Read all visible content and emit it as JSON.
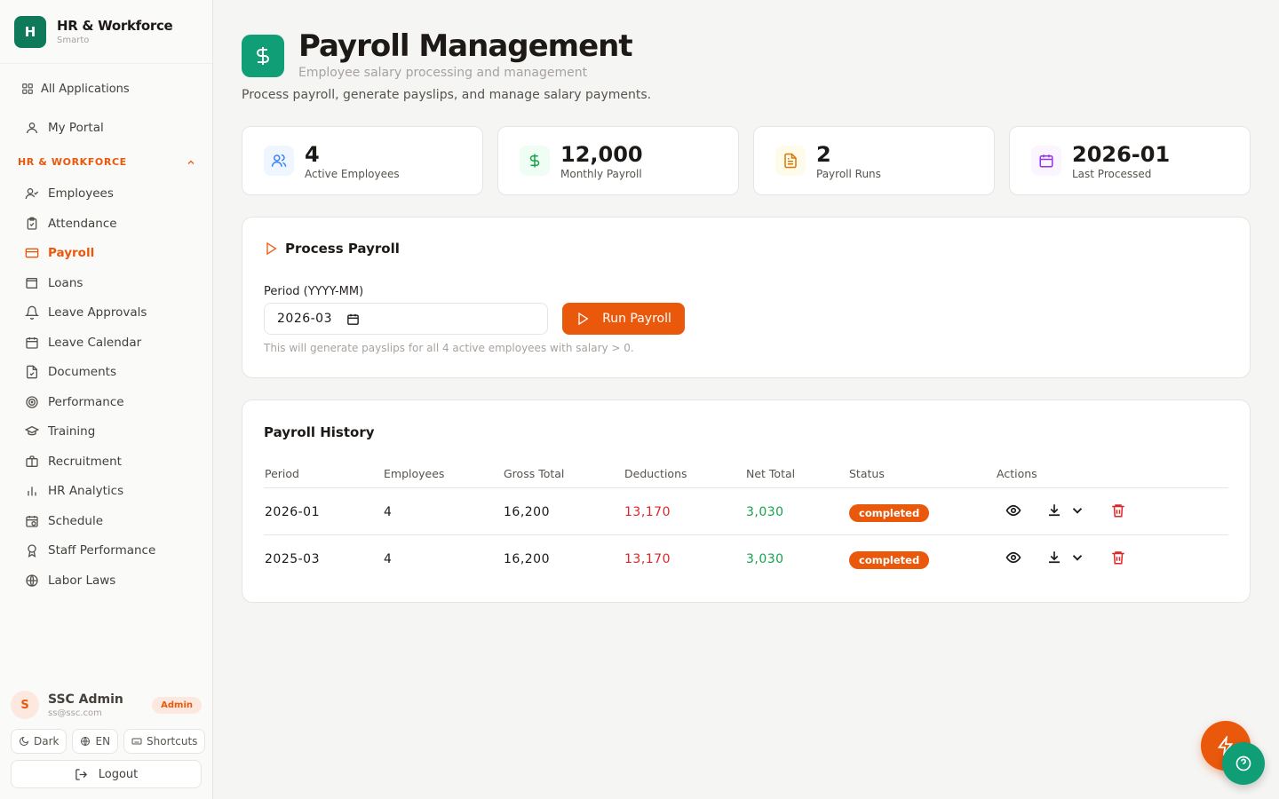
{
  "brand": {
    "logo_letter": "H",
    "title": "HR & Workforce",
    "subtitle": "Smarto"
  },
  "sidebar": {
    "all_apps": "All Applications",
    "my_portal": "My Portal",
    "section_title": "HR & WORKFORCE",
    "items": [
      {
        "label": "Employees",
        "icon": "user-check-icon"
      },
      {
        "label": "Attendance",
        "icon": "clipboard-check-icon"
      },
      {
        "label": "Payroll",
        "icon": "credit-card-icon",
        "active": true
      },
      {
        "label": "Loans",
        "icon": "wallet-icon"
      },
      {
        "label": "Leave Approvals",
        "icon": "bell-icon"
      },
      {
        "label": "Leave Calendar",
        "icon": "calendar-icon"
      },
      {
        "label": "Documents",
        "icon": "file-check-icon"
      },
      {
        "label": "Performance",
        "icon": "target-icon"
      },
      {
        "label": "Training",
        "icon": "graduation-cap-icon"
      },
      {
        "label": "Recruitment",
        "icon": "briefcase-icon"
      },
      {
        "label": "HR Analytics",
        "icon": "bar-chart-icon"
      },
      {
        "label": "Schedule",
        "icon": "calendar-clock-icon"
      },
      {
        "label": "Staff Performance",
        "icon": "award-icon"
      },
      {
        "label": "Labor Laws",
        "icon": "globe-icon"
      }
    ]
  },
  "user": {
    "initial": "S",
    "name": "SSC Admin",
    "email": "ss@ssc.com",
    "role": "Admin"
  },
  "footer": {
    "dark": "Dark",
    "lang": "EN",
    "shortcuts": "Shortcuts",
    "logout": "Logout"
  },
  "page": {
    "title": "Payroll Management",
    "subtitle": "Employee salary processing and management",
    "description": "Process payroll, generate payslips, and manage salary payments."
  },
  "stats": [
    {
      "value": "4",
      "label": "Active Employees",
      "icon": "users-icon",
      "color": "#3b82f6",
      "bg": "#eff6ff"
    },
    {
      "value": "12,000",
      "label": "Monthly Payroll",
      "icon": "dollar-icon",
      "color": "#16a34a",
      "bg": "#f0fdf4"
    },
    {
      "value": "2",
      "label": "Payroll Runs",
      "icon": "file-text-icon",
      "color": "#d97706",
      "bg": "#fffbeb"
    },
    {
      "value": "2026-01",
      "label": "Last Processed",
      "icon": "calendar-icon",
      "color": "#9333ea",
      "bg": "#faf5ff"
    }
  ],
  "process": {
    "title": "Process Payroll",
    "period_label": "Period (YYYY-MM)",
    "period_value": "2026-03",
    "run_label": "Run Payroll",
    "help": "This will generate payslips for all 4 active employees with salary > 0."
  },
  "history": {
    "title": "Payroll History",
    "columns": [
      "Period",
      "Employees",
      "Gross Total",
      "Deductions",
      "Net Total",
      "Status",
      "Actions"
    ],
    "rows": [
      {
        "period": "2026-01",
        "employees": "4",
        "gross": "16,200",
        "deductions": "13,170",
        "net": "3,030",
        "status": "completed"
      },
      {
        "period": "2025-03",
        "employees": "4",
        "gross": "16,200",
        "deductions": "13,170",
        "net": "3,030",
        "status": "completed"
      }
    ]
  },
  "colors": {
    "accent": "#ea580c",
    "brand": "#0f9e75",
    "danger": "#dc2626",
    "success": "#16a34a"
  }
}
